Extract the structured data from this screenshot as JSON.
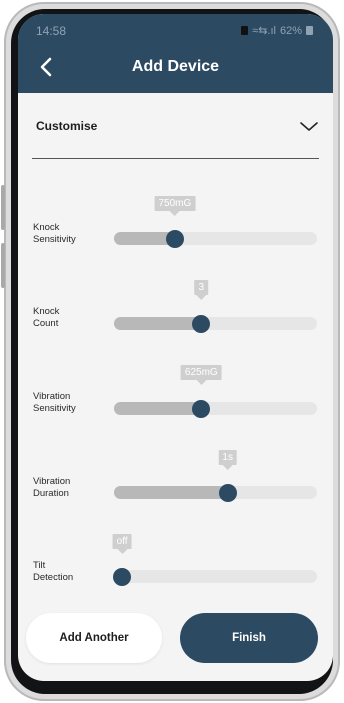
{
  "status_bar": {
    "time": "14:58",
    "signal": "≈⇆.ıl",
    "battery": "62%"
  },
  "header": {
    "title": "Add Device",
    "back_icon": "chevron-left-icon"
  },
  "dropdown": {
    "label": "Customise",
    "icon": "chevron-down-icon"
  },
  "settings": [
    {
      "label_line1": "Knock",
      "label_line2": "Sensitivity",
      "value_label": "750mG",
      "level_percent": 30
    },
    {
      "label_line1": "Knock",
      "label_line2": "Count",
      "value_label": "3",
      "level_percent": 43
    },
    {
      "label_line1": "Vibration",
      "label_line2": "Sensitivity",
      "value_label": "625mG",
      "level_percent": 43
    },
    {
      "label_line1": "Vibration",
      "label_line2": "Duration",
      "value_label": "1s",
      "level_percent": 56
    },
    {
      "label_line1": "Tilt",
      "label_line2": "Detection",
      "value_label": "off",
      "level_percent": 4
    }
  ],
  "buttons": {
    "add_another": "Add Another",
    "finish": "Finish"
  },
  "colors": {
    "primary": "#2d4a63",
    "background": "#f4f4f4",
    "track": "#e6e6e6",
    "fill": "#b8b8b8",
    "tooltip": "#cfcfcf"
  }
}
